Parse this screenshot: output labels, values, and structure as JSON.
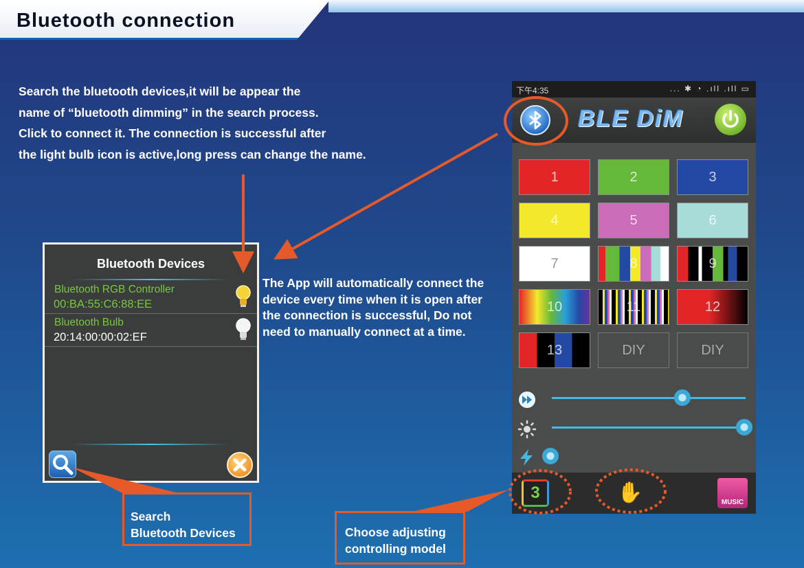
{
  "page": {
    "title": "Bluetooth connection",
    "intro_lines": [
      "Search the bluetooth devices,it will be appear the",
      "name of “bluetooth dimming” in the search process.",
      "Click to connect it. The connection is successful after",
      "the light bulb icon is active,long press can change the name."
    ],
    "auto_connect_lines": [
      "The App will automatically connect the",
      "device every time when it is open after",
      "the connection is successful, Do not",
      "need to manually connect at a time."
    ]
  },
  "dialog": {
    "title": "Bluetooth Devices",
    "devices": [
      {
        "name": "Bluetooth RGB Controller",
        "address": "00:BA:55:C6:88:EE",
        "active": true
      },
      {
        "name": "Bluetooth Bulb",
        "address": "20:14:00:00:02:EF",
        "active": false
      }
    ],
    "search_icon": "search-icon",
    "close_icon": "close-icon"
  },
  "callouts": {
    "search": [
      "Search",
      "Bluetooth Devices"
    ],
    "mode": [
      "Choose adjusting",
      "controlling model"
    ]
  },
  "phone": {
    "status_time": "下午4:35",
    "status_icons": "... ✱ ◔ .ıll .ıll ▭",
    "app_name": "BLE DiM",
    "tiles": [
      {
        "label": "1",
        "fill": "#e42527"
      },
      {
        "label": "2",
        "fill": "#64b93a"
      },
      {
        "label": "3",
        "fill": "#2449a4"
      },
      {
        "label": "4",
        "fill": "#f4e82b"
      },
      {
        "label": "5",
        "fill": "#ca6cb8"
      },
      {
        "label": "6",
        "fill": "#a8dcd8"
      },
      {
        "label": "7",
        "fill": "#ffffff"
      },
      {
        "label": "8",
        "fill": "stripes-a"
      },
      {
        "label": "9",
        "fill": "stripes-b"
      },
      {
        "label": "10",
        "fill": "rainbow"
      },
      {
        "label": "11",
        "fill": "stripes-c"
      },
      {
        "label": "12",
        "fill": "red-fade"
      },
      {
        "label": "13",
        "fill": "stripes-d"
      },
      {
        "label": "DIY",
        "fill": "none"
      },
      {
        "label": "DIY",
        "fill": "none"
      }
    ],
    "sliders": [
      {
        "icon": "speed-icon",
        "value": 0.68
      },
      {
        "icon": "brightness-icon",
        "value": 1.0
      },
      {
        "icon": "flash-icon",
        "value": 0.0
      }
    ],
    "bottom": {
      "mode_number": "3",
      "music_label": "MUSIC"
    }
  }
}
